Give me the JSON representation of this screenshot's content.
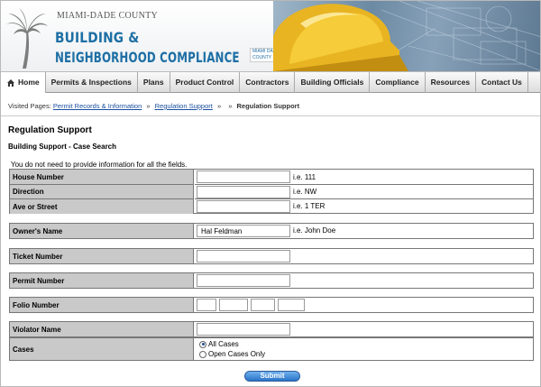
{
  "header": {
    "county": "MIAMI-DADE COUNTY",
    "title_line1": "BUILDING &",
    "title_line2": "NEIGHBORHOOD COMPLIANCE",
    "logo_small": "MIAMI DADE COUNTY"
  },
  "nav": {
    "items": [
      {
        "label": "Home"
      },
      {
        "label": "Permits & Inspections"
      },
      {
        "label": "Plans"
      },
      {
        "label": "Product Control"
      },
      {
        "label": "Contractors"
      },
      {
        "label": "Building Officials"
      },
      {
        "label": "Compliance"
      },
      {
        "label": "Resources"
      },
      {
        "label": "Contact Us"
      }
    ]
  },
  "breadcrumb": {
    "prefix": "Visited Pages:",
    "link1": "Permit Records & Information",
    "link2": "Regulation Support",
    "sep": "»",
    "current": "Regulation Support"
  },
  "page": {
    "title": "Regulation Support",
    "section": "Building Support - Case Search",
    "note": "You do not need to provide information for all the fields."
  },
  "form": {
    "house_number": {
      "label": "House Number",
      "value": "",
      "hint": "i.e. 111"
    },
    "direction": {
      "label": "Direction",
      "value": "",
      "hint": "i.e. NW"
    },
    "ave_street": {
      "label": "Ave or Street",
      "value": "",
      "hint": "i.e. 1 TER"
    },
    "owners_name": {
      "label": "Owner's Name",
      "value": "Hal Feldman",
      "hint": "i.e. John Doe"
    },
    "ticket_number": {
      "label": "Ticket Number",
      "value": ""
    },
    "permit_number": {
      "label": "Permit Number",
      "value": ""
    },
    "folio_number": {
      "label": "Folio Number",
      "values": [
        "",
        "",
        "",
        ""
      ]
    },
    "violator_name": {
      "label": "Violator Name",
      "value": ""
    },
    "cases": {
      "label": "Cases",
      "options": [
        "All Cases",
        "Open Cases Only"
      ],
      "selected": "All Cases"
    },
    "submit_label": "Submit"
  },
  "colors": {
    "brand_blue": "#1d6fa5",
    "label_bg": "#c9c9c9",
    "link": "#1a4fa0"
  }
}
